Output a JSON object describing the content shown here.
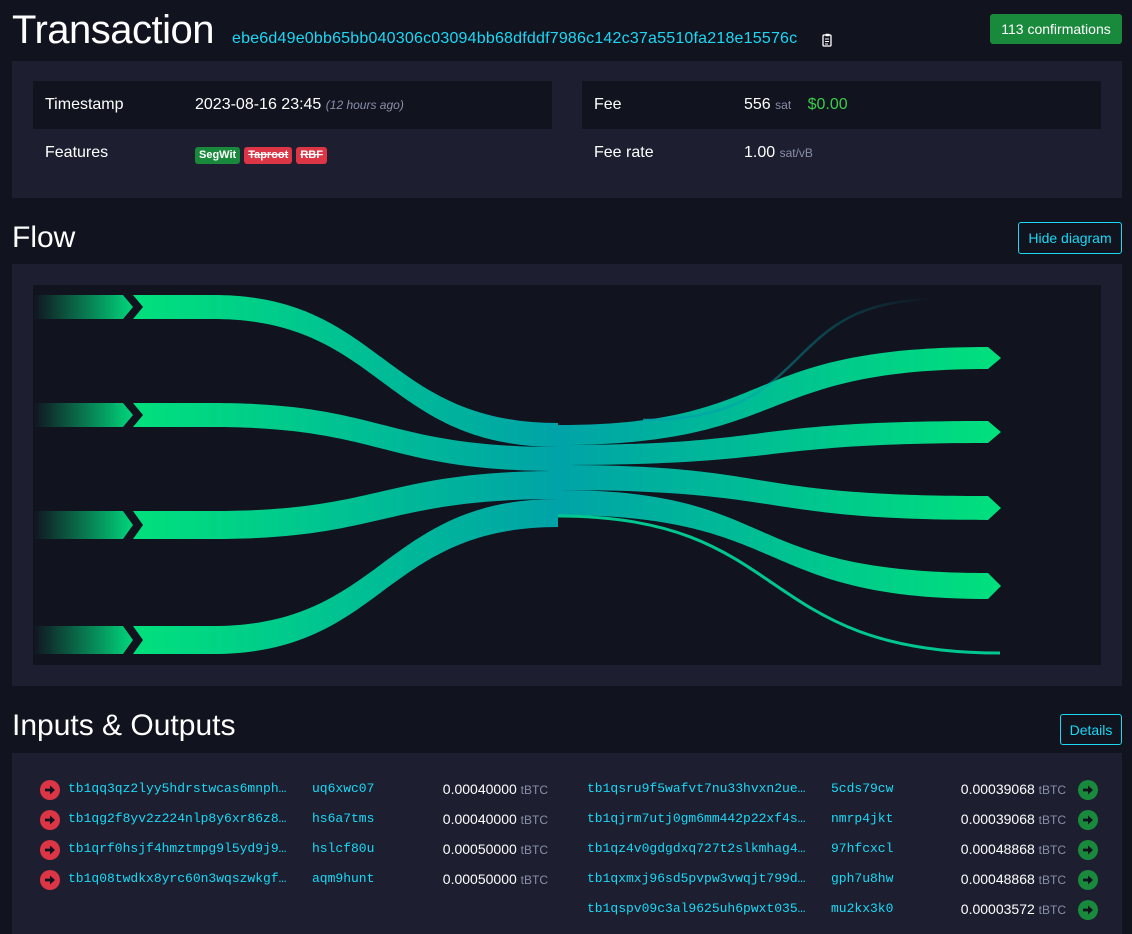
{
  "header": {
    "title": "Transaction",
    "txid": "ebe6d49e0bb65bb040306c03094bb68dfddf7986c142c37a5510fa218e15576c",
    "confirmations": "113 confirmations"
  },
  "summary": {
    "timestamp_label": "Timestamp",
    "timestamp_value": "2023-08-16 23:45",
    "timestamp_ago": "(12 hours ago)",
    "features_label": "Features",
    "features": [
      {
        "label": "SegWit",
        "status": "active"
      },
      {
        "label": "Taproot",
        "status": "inactive"
      },
      {
        "label": "RBF",
        "status": "inactive"
      }
    ],
    "fee_label": "Fee",
    "fee_value": "556",
    "fee_unit": "sat",
    "fee_fiat": "$0.00",
    "feerate_label": "Fee rate",
    "feerate_value": "1.00",
    "feerate_unit": "sat/vB"
  },
  "flow": {
    "title": "Flow",
    "hide_button": "Hide diagram"
  },
  "io": {
    "title": "Inputs & Outputs",
    "details_button": "Details",
    "unit": "tBTC",
    "inputs": [
      {
        "addr_start": "tb1qq3qz2lyy5hdrstwcas6mnph…",
        "addr_end": "uq6xwc07",
        "amount": "0.00040000"
      },
      {
        "addr_start": "tb1qg2f8yv2z224nlp8y6xr86z8…",
        "addr_end": "hs6a7tms",
        "amount": "0.00040000"
      },
      {
        "addr_start": "tb1qrf0hsjf4hmztmpg9l5yd9j9…",
        "addr_end": "hslcf80u",
        "amount": "0.00050000"
      },
      {
        "addr_start": "tb1q08twdkx8yrc60n3wqszwkgf…",
        "addr_end": "aqm9hunt",
        "amount": "0.00050000"
      }
    ],
    "outputs": [
      {
        "addr_start": "tb1qsru9f5wafvt7nu33hvxn2ue…",
        "addr_end": "5cds79cw",
        "amount": "0.00039068"
      },
      {
        "addr_start": "tb1qjrm7utj0gm6mm442p22xf4s…",
        "addr_end": "nmrp4jkt",
        "amount": "0.00039068"
      },
      {
        "addr_start": "tb1qz4v0gdgdxq727t2slkmhag4…",
        "addr_end": "97hfcxcl",
        "amount": "0.00048868"
      },
      {
        "addr_start": "tb1qxmxj96sd5pvpw3vwqjt799d…",
        "addr_end": "gph7u8hw",
        "amount": "0.00048868"
      },
      {
        "addr_start": "tb1qspv09c3al9625uh6pwxt035…",
        "addr_end": "mu2kx3k0",
        "amount": "0.00003572"
      }
    ]
  },
  "colors": {
    "accent": "#1bd8f4",
    "success": "#198a3c",
    "danger": "#dc3545",
    "panel": "#1d1f31",
    "background": "#11131f"
  }
}
